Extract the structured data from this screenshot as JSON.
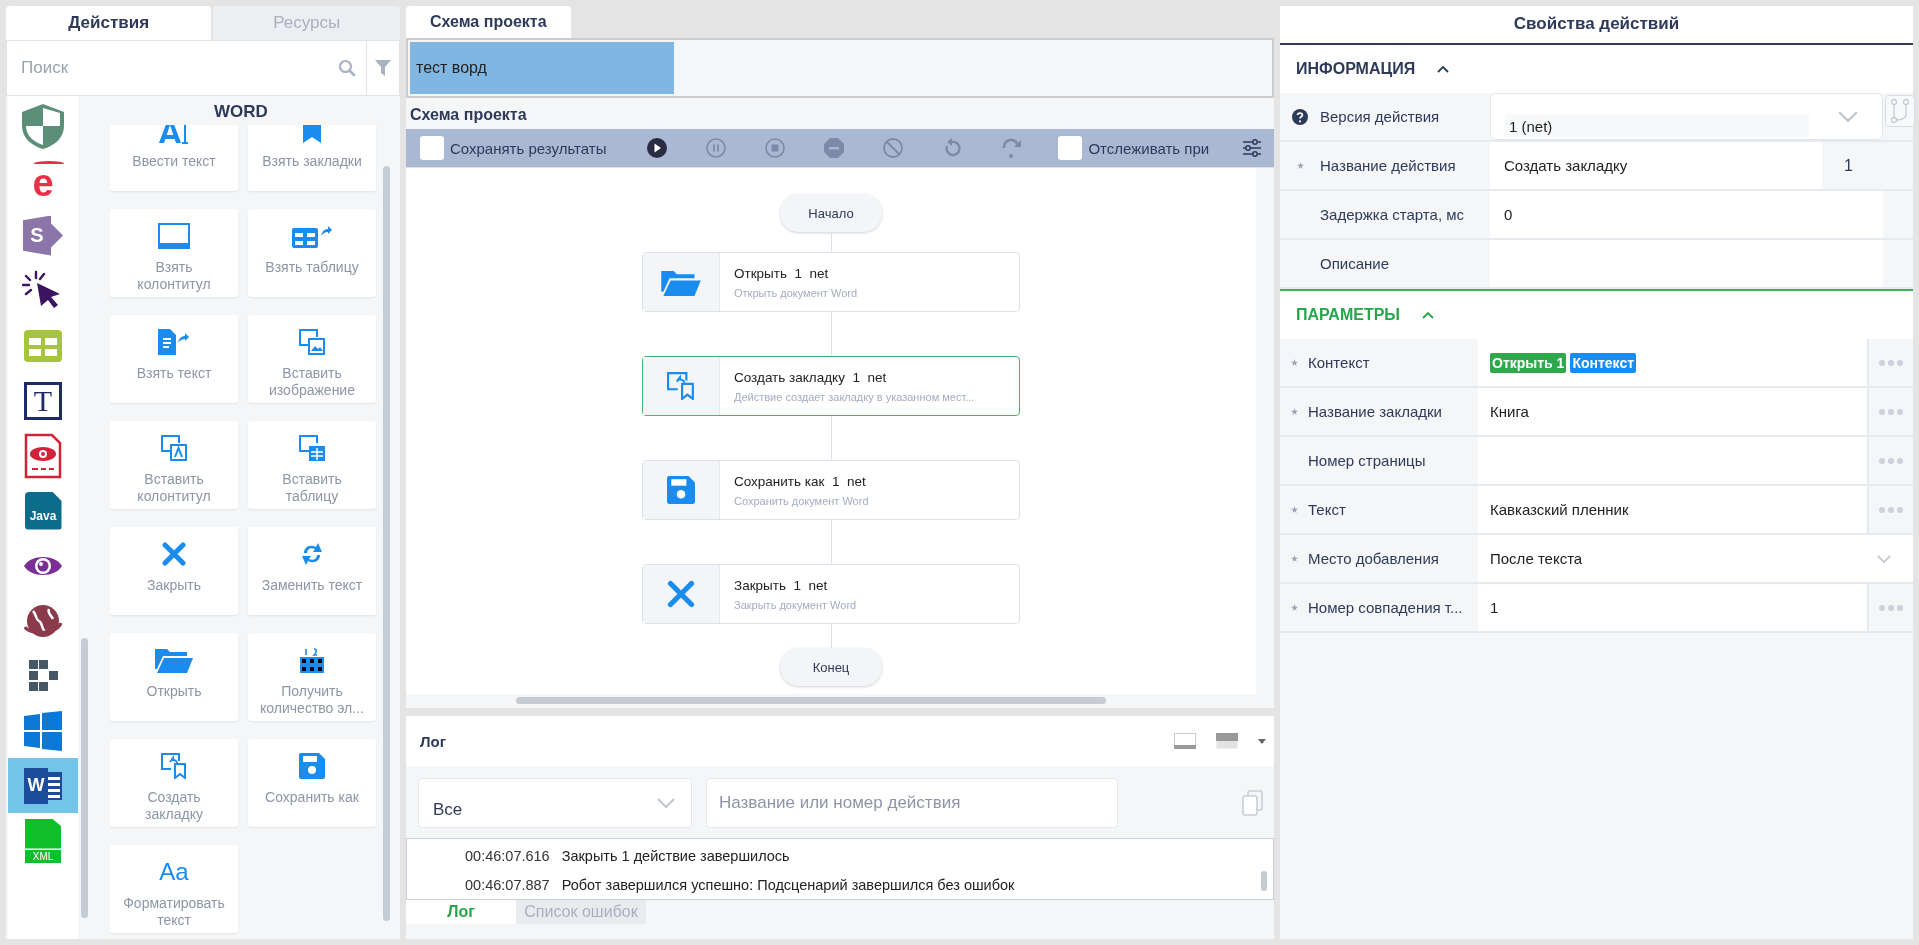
{
  "left_tabs": [
    {
      "label": "Действия",
      "selected": true
    },
    {
      "label": "Ресурсы",
      "selected": false
    }
  ],
  "search": {
    "placeholder": "Поиск"
  },
  "rail": [
    {
      "kind": "shield",
      "selected": false
    },
    {
      "kind": "browser",
      "text": "e",
      "selected": false
    },
    {
      "kind": "sharepoint",
      "text": "S",
      "selected": false
    },
    {
      "kind": "cursor",
      "selected": false
    },
    {
      "kind": "grid",
      "selected": false
    },
    {
      "kind": "textframe",
      "text": "T",
      "selected": false
    },
    {
      "kind": "pdf",
      "selected": false
    },
    {
      "kind": "java",
      "text": "Java",
      "selected": false
    },
    {
      "kind": "eye",
      "selected": false
    },
    {
      "kind": "globe",
      "selected": false
    },
    {
      "kind": "blocks",
      "selected": false
    },
    {
      "kind": "windows",
      "selected": false
    },
    {
      "kind": "word",
      "text": "W",
      "selected": true
    },
    {
      "kind": "xml",
      "text": "XML",
      "selected": false
    }
  ],
  "group_title": "WORD",
  "actions": [
    {
      "label": "Ввести текст",
      "kind": "type"
    },
    {
      "label": "Взять закладки",
      "kind": "bookmark"
    },
    {
      "label": "Взять колонтитул",
      "kind": "footer"
    },
    {
      "label": "Взять таблицу",
      "kind": "table-arrow"
    },
    {
      "label": "Взять текст",
      "kind": "doc-arrow"
    },
    {
      "label": "Вставить изображение",
      "kind": "insert-image"
    },
    {
      "label": "Вставить колонтитул",
      "kind": "insert-doc"
    },
    {
      "label": "Вставить таблицу",
      "kind": "insert-table"
    },
    {
      "label": "Закрыть",
      "kind": "close"
    },
    {
      "label": "Заменить текст",
      "kind": "replace"
    },
    {
      "label": "Открыть",
      "kind": "folder"
    },
    {
      "label": "Получить количество эл...",
      "kind": "count"
    },
    {
      "label": "Создать закладку",
      "kind": "create-bookmark"
    },
    {
      "label": "Сохранить как",
      "kind": "save"
    },
    {
      "label": "Форматировать текст",
      "kind": "format",
      "glyph": "Aa"
    }
  ],
  "project_tabs": [
    {
      "label": "Схема проекта",
      "selected": true
    }
  ],
  "documents": [
    {
      "label": "тест ворд",
      "selected": true
    }
  ],
  "schema_title": "Схема проекта",
  "toolbar": {
    "save_results": {
      "label": "Сохранять результаты",
      "checked": false
    },
    "buttons": [
      {
        "kind": "play",
        "disabled": false
      },
      {
        "kind": "pause",
        "disabled": true
      },
      {
        "kind": "stop",
        "disabled": true
      },
      {
        "kind": "minus",
        "disabled": true
      },
      {
        "kind": "block",
        "disabled": true
      },
      {
        "kind": "undo",
        "disabled": true
      },
      {
        "kind": "redo",
        "disabled": true
      }
    ],
    "track": {
      "label": "Отслеживать при",
      "checked": false
    }
  },
  "flow": [
    {
      "kind": "terminal",
      "label": "Начало"
    },
    {
      "kind": "folder",
      "name": "Открыть",
      "number": "1",
      "version": "net",
      "subtitle": "Открыть документ Word",
      "selected": false
    },
    {
      "kind": "create-bookmark",
      "name": "Создать закладку",
      "number": "1",
      "version": "net",
      "subtitle": "Действие создает закладку в указанном мест...",
      "selected": true
    },
    {
      "kind": "save",
      "name": "Сохранить как",
      "number": "1",
      "version": "net",
      "subtitle": "Сохранить документ Word",
      "selected": false
    },
    {
      "kind": "close",
      "name": "Закрыть",
      "number": "1",
      "version": "net",
      "subtitle": "Закрыть документ Word",
      "selected": false
    },
    {
      "kind": "terminal",
      "label": "Конец"
    }
  ],
  "log": {
    "title": "Лог",
    "filter": "Все",
    "search_placeholder": "Название или номер действия",
    "entries": [
      {
        "time": "00:46:07.616",
        "message": "Закрыть 1 действие завершилось"
      },
      {
        "time": "00:46:07.887",
        "message": "Робот завершился успешно: Подсценарий завершился без ошибок"
      }
    ],
    "tabs": [
      {
        "label": "Лог",
        "selected": true
      },
      {
        "label": "Список ошибок",
        "selected": false
      }
    ]
  },
  "properties": {
    "title": "Свойства действий",
    "sections": [
      {
        "title": "ИНФОРМАЦИЯ",
        "expanded": true,
        "color": "#2e3a59",
        "rows": [
          {
            "label": "Версия действия",
            "help": true,
            "kind": "select",
            "value": "1 (net)",
            "branch_button": true
          },
          {
            "label": "Название действия",
            "required": true,
            "kind": "text",
            "value": "Создать закладку",
            "suffix": "1"
          },
          {
            "label": "Задержка старта, мс",
            "required": false,
            "kind": "text",
            "value": "0"
          },
          {
            "label": "Описание",
            "required": false,
            "kind": "text"
          }
        ]
      },
      {
        "title": "ПАРАМЕТРЫ",
        "expanded": true,
        "color": "#27a54a",
        "rows": [
          {
            "label": "Контекст",
            "required": true,
            "kind": "tokens",
            "tokens": [
              {
                "text": "Открыть 1",
                "color": "#2ea84a"
              },
              {
                "text": "Контекст",
                "color": "#1a8cf0"
              }
            ],
            "more": true
          },
          {
            "label": "Название закладки",
            "required": true,
            "kind": "text",
            "value": "Книга",
            "more": true
          },
          {
            "label": "Номер страницы",
            "required": false,
            "kind": "text",
            "more": true
          },
          {
            "label": "Текст",
            "required": true,
            "kind": "text",
            "value": "Кавказский пленник",
            "more": true
          },
          {
            "label": "Место добавления",
            "required": true,
            "kind": "select",
            "value": "После текста"
          },
          {
            "label": "Номер совпадения т...",
            "required": true,
            "kind": "text",
            "value": "1",
            "more": true
          }
        ]
      }
    ]
  }
}
